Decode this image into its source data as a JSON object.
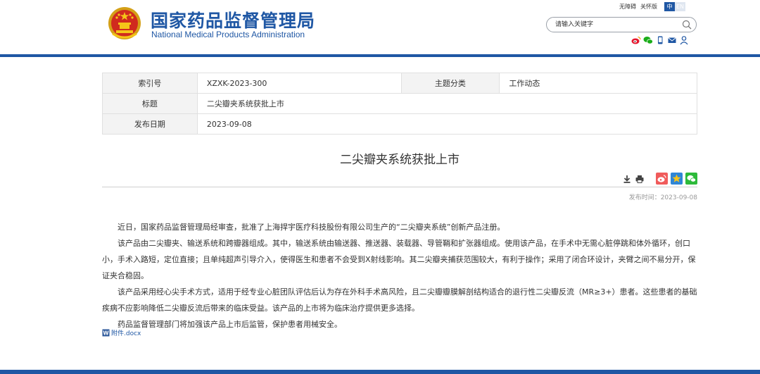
{
  "header": {
    "logo_cn": "国家药品监督管理局",
    "logo_en": "National Medical Products Administration",
    "emblem_icon": "national-emblem-icon",
    "toplinks": [
      "无障碍",
      "关怀版"
    ],
    "lang_cn": "中",
    "lang_en": "EN",
    "search_placeholder": "请输入关键字",
    "social_icons": [
      "weibo-icon",
      "wechat-icon",
      "mobile-icon",
      "mail-icon",
      "user-icon"
    ],
    "brand_color": "#1f57a4"
  },
  "meta": {
    "index_label": "索引号",
    "index_value": "XZXK-2023-300",
    "topic_label": "主题分类",
    "topic_value": "工作动态",
    "title_label": "标题",
    "title_value": "二尖瓣夹系统获批上市",
    "date_label": "发布日期",
    "date_value": "2023-09-08"
  },
  "article": {
    "title": "二尖瓣夹系统获批上市",
    "tool_icons": [
      "download-icon",
      "print-icon",
      "weibo-share-icon",
      "favorite-share-icon",
      "wechat-share-icon"
    ],
    "pubdate": "发布时间：2023-09-08",
    "paragraphs": [
      "近日，国家药品监督管理局经审查，批准了上海捍宇医疗科技股份有限公司生产的“二尖瓣夹系统”创新产品注册。",
      "该产品由二尖瓣夹、输送系统和跨瓣器组成。其中，输送系统由输送器、推送器、装载器、导管鞘和扩张器组成。使用该产品，在手术中无需心脏停跳和体外循环，创口小，手术入路短，定位直接；且单纯超声引导介入，使得医生和患者不会受到X射线影响。其二尖瓣夹捕获范围较大，有利于操作；采用了闭合环设计，夹臂之间不易分开，保证夹合稳固。",
      "该产品采用经心尖手术方式，适用于经专业心脏团队评估后认为存在外科手术高风险，且二尖瓣瓣膜解剖结构适合的退行性二尖瓣反流（MR≥3+）患者。这些患者的基础疾病不应影响降低二尖瓣反流后带来的临床受益。该产品的上市将为临床治疗提供更多选择。",
      "药品监督管理部门将加强该产品上市后监管，保护患者用械安全。"
    ],
    "attachment": "附件.docx"
  }
}
